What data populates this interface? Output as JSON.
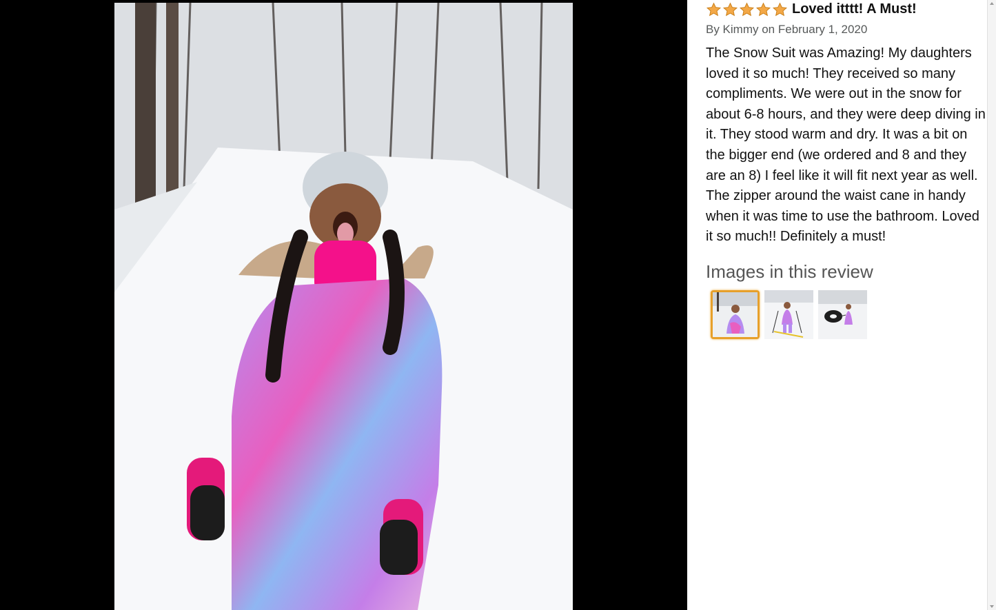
{
  "viewer": {
    "main_image": "girl-in-snowsuit-photo"
  },
  "review": {
    "rating": 5,
    "max_rating": 5,
    "star_icon": "star-icon",
    "star_color": "#f3a847",
    "title": "Loved itttt! A Must!",
    "byline": "By Kimmy on February 1, 2020",
    "body": "The Snow Suit was Amazing! My daughters loved it so much! They received so many compliments. We were out in the snow for about 6-8 hours, and they were deep diving in it. They stood warm and dry. It was a bit on the bigger end (we ordered and 8 and they are an 8) I feel like it will fit next year as well. The zipper around the waist cane in handy when it was time to use the bathroom. Loved it so much!! Definitely a must!"
  },
  "images_section": {
    "heading": "Images in this review",
    "selected_index": 0,
    "selected_border_color": "#e7a02b"
  }
}
